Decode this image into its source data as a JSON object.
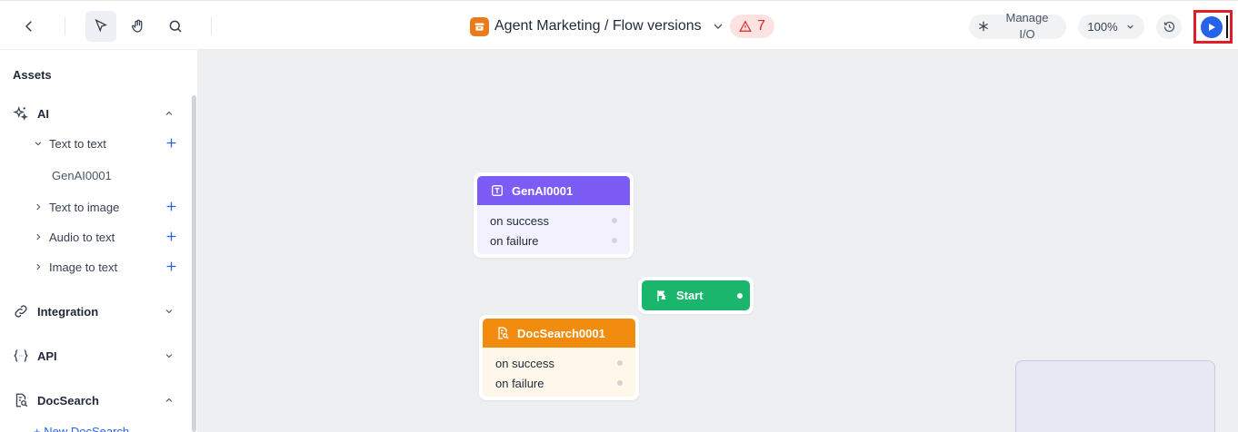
{
  "toolbar": {
    "title": "Agent Marketing / Flow versions",
    "warning_count": "7",
    "manage_io_label": "Manage I/O",
    "zoom_level": "100%"
  },
  "sidebar": {
    "title": "Assets",
    "sections": {
      "ai": {
        "label": "AI",
        "groups": {
          "text_to_text": {
            "label": "Text to text",
            "items": [
              "GenAI0001"
            ]
          },
          "text_to_image": {
            "label": "Text to image"
          },
          "audio_to_text": {
            "label": "Audio to text"
          },
          "image_to_text": {
            "label": "Image to text"
          }
        }
      },
      "integration": {
        "label": "Integration"
      },
      "api": {
        "label": "API"
      },
      "docsearch": {
        "label": "DocSearch",
        "new_label": "+ New DocSearch"
      }
    }
  },
  "canvas": {
    "nodes": {
      "genai": {
        "title": "GenAI0001",
        "color": "#7c5cf5",
        "ports": [
          "on success",
          "on failure"
        ]
      },
      "start": {
        "title": "Start",
        "color": "#1bb66e"
      },
      "docsearch": {
        "title": "DocSearch0001",
        "color": "#f28c0f",
        "ports": [
          "on success",
          "on failure"
        ]
      }
    }
  },
  "colors": {
    "accent": "#2563eb",
    "warning": "#dc2626",
    "highlight_box": "#e11d2a"
  }
}
